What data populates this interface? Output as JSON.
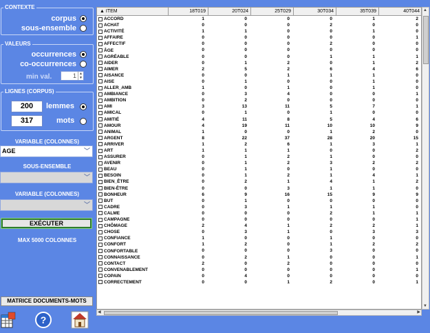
{
  "contexte": {
    "title": "CONTEXTE",
    "options": [
      {
        "label": "corpus",
        "selected": true
      },
      {
        "label": "sous-ensemble",
        "selected": false
      }
    ]
  },
  "valeurs": {
    "title": "VALEURS",
    "options": [
      {
        "label": "occurrences",
        "selected": true
      },
      {
        "label": "co-occurrences",
        "selected": false
      }
    ],
    "min_label": "min val.",
    "min_value": "1"
  },
  "lignes": {
    "title": "LIGNES (CORPUS)",
    "lemmes_value": "200",
    "lemmes_label": "lemmes",
    "mots_value": "317",
    "mots_label": "mots",
    "lemmes_selected": true
  },
  "variable1": {
    "label": "VARIABLE (COLONNES)",
    "value": "AGE"
  },
  "sous_ensemble": {
    "label": "SOUS-ENSEMBLE",
    "value": ""
  },
  "variable2": {
    "label": "VARIABLE (COLONNES)",
    "value": ""
  },
  "execute_label": "EXÉCUTER",
  "max_label": "MAX 5000 COLONNES",
  "matrice_label": "MATRICE DOCUMENTS-MOTS",
  "icons": [
    "spreadsheet-icon",
    "help-icon",
    "home-icon"
  ],
  "hscroll_label": "18T019",
  "grid": {
    "columns": [
      "ITEM",
      "18T019",
      "20T024",
      "25T029",
      "30T034",
      "35T039",
      "40T044"
    ],
    "rows": [
      [
        "ACCORD",
        "1",
        "0",
        "0",
        "0",
        "1",
        "2"
      ],
      [
        "ACHAT",
        "0",
        "0",
        "0",
        "2",
        "0",
        "0"
      ],
      [
        "ACTIVITÉ",
        "1",
        "1",
        "0",
        "0",
        "1",
        "0"
      ],
      [
        "AFFAIRE",
        "0",
        "0",
        "0",
        "0",
        "0",
        "1"
      ],
      [
        "AFFECTIF",
        "0",
        "0",
        "0",
        "2",
        "0",
        "0"
      ],
      [
        "ÂGE",
        "0",
        "0",
        "0",
        "0",
        "0",
        "0"
      ],
      [
        "AGRÉABLE",
        "0",
        "0",
        "0",
        "1",
        "1",
        "1"
      ],
      [
        "AIDER",
        "0",
        "1",
        "2",
        "0",
        "1",
        "2"
      ],
      [
        "AIMER",
        "2",
        "5",
        "2",
        "6",
        "4",
        "6"
      ],
      [
        "AISANCE",
        "0",
        "0",
        "1",
        "1",
        "1",
        "0"
      ],
      [
        "AISE",
        "0",
        "1",
        "0",
        "0",
        "1",
        "0"
      ],
      [
        "ALLER_AMB",
        "1",
        "0",
        "1",
        "0",
        "1",
        "0"
      ],
      [
        "AMBIANCE",
        "0",
        "3",
        "4",
        "0",
        "0",
        "1"
      ],
      [
        "AMBITION",
        "0",
        "2",
        "0",
        "0",
        "0",
        "0"
      ],
      [
        "AMI",
        "3",
        "13",
        "11",
        "5",
        "7",
        "1"
      ],
      [
        "AMICAL",
        "0",
        "1",
        "0",
        "1",
        "0",
        "0"
      ],
      [
        "AMITIÉ",
        "4",
        "11",
        "8",
        "5",
        "4",
        "6"
      ],
      [
        "AMOUR",
        "4",
        "19",
        "11",
        "10",
        "10",
        "9"
      ],
      [
        "ANIMAL",
        "1",
        "0",
        "0",
        "1",
        "2",
        "0"
      ],
      [
        "ARGENT",
        "8",
        "22",
        "37",
        "28",
        "20",
        "15"
      ],
      [
        "ARRIVER",
        "1",
        "2",
        "6",
        "1",
        "3",
        "1"
      ],
      [
        "ART",
        "1",
        "1",
        "1",
        "0",
        "0",
        "2"
      ],
      [
        "ASSURER",
        "0",
        "1",
        "2",
        "1",
        "0",
        "0"
      ],
      [
        "AVENIR",
        "0",
        "1",
        "2",
        "3",
        "2",
        "2"
      ],
      [
        "BEAU",
        "0",
        "1",
        "0",
        "1",
        "0",
        "0"
      ],
      [
        "BESOIN",
        "0",
        "1",
        "2",
        "1",
        "4",
        "1"
      ],
      [
        "BIEN_ÊTRE",
        "0",
        "2",
        "1",
        "4",
        "1",
        "2"
      ],
      [
        "BIEN-ÊTRE",
        "0",
        "0",
        "3",
        "1",
        "1",
        "0"
      ],
      [
        "BONHEUR",
        "6",
        "9",
        "16",
        "15",
        "9",
        "9"
      ],
      [
        "BUT",
        "0",
        "1",
        "0",
        "0",
        "0",
        "0"
      ],
      [
        "CADRE",
        "0",
        "3",
        "1",
        "1",
        "1",
        "0"
      ],
      [
        "CALME",
        "0",
        "0",
        "0",
        "2",
        "1",
        "1"
      ],
      [
        "CAMPAGNE",
        "0",
        "0",
        "0",
        "0",
        "0",
        "1"
      ],
      [
        "CHÔMAGE",
        "2",
        "4",
        "1",
        "2",
        "2",
        "1"
      ],
      [
        "CHOSE",
        "0",
        "3",
        "1",
        "0",
        "3",
        "3"
      ],
      [
        "CONFIANCE",
        "1",
        "0",
        "0",
        "1",
        "0",
        "0"
      ],
      [
        "CONFORT",
        "1",
        "2",
        "0",
        "1",
        "2",
        "2"
      ],
      [
        "CONFORTABLE",
        "0",
        "0",
        "0",
        "3",
        "0",
        "0"
      ],
      [
        "CONNAISSANCE",
        "0",
        "2",
        "1",
        "0",
        "0",
        "1"
      ],
      [
        "CONTACT",
        "2",
        "0",
        "2",
        "0",
        "0",
        "0"
      ],
      [
        "CONVENABLEMENT",
        "0",
        "0",
        "0",
        "0",
        "0",
        "1"
      ],
      [
        "COPAIN",
        "0",
        "4",
        "0",
        "0",
        "0",
        "0"
      ],
      [
        "CORRECTEMENT",
        "0",
        "0",
        "1",
        "2",
        "0",
        "1"
      ]
    ]
  }
}
